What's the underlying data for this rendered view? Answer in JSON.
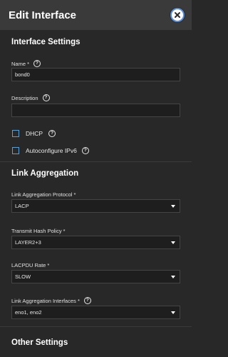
{
  "header": {
    "title": "Edit Interface",
    "close_icon": "close-circle-icon"
  },
  "interface_settings": {
    "title": "Interface Settings",
    "name_label": "Name *",
    "name_value": "bond0",
    "description_label": "Description",
    "description_value": "",
    "dhcp_label": "DHCP",
    "dhcp_checked": false,
    "ipv6_label": "Autoconfigure IPv6",
    "ipv6_checked": false
  },
  "link_aggregation": {
    "title": "Link Aggregation",
    "protocol_label": "Link Aggregation Protocol *",
    "protocol_value": "LACP",
    "hash_label": "Transmit Hash Policy *",
    "hash_value": "LAYER2+3",
    "rate_label": "LACPDU Rate *",
    "rate_value": "SLOW",
    "interfaces_label": "Link Aggregation Interfaces *",
    "interfaces_value": "eno1, eno2"
  },
  "other_settings": {
    "title": "Other Settings"
  },
  "colors": {
    "background": "#282828",
    "header": "#3a3a3a",
    "input_bg": "#1e1e1e",
    "accent": "#5a9fd6"
  }
}
